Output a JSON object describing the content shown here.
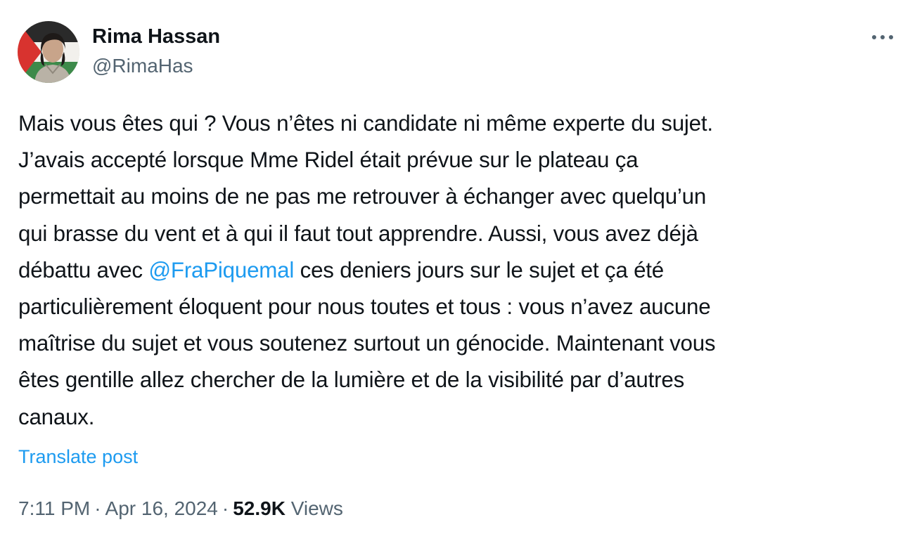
{
  "author": {
    "display_name": "Rima Hassan",
    "handle": "@RimaHas"
  },
  "post": {
    "lines": [
      [
        "Mais vous êtes qui ? Vous n’êtes ni candidate ni même experte du sujet."
      ],
      [
        "J’avais accepté lorsque Mme Ridel était prévue sur le plateau ça"
      ],
      [
        "permettait au moins de ne pas me retrouver à échanger avec quelqu’un"
      ],
      [
        "qui brasse du vent et à qui il faut tout apprendre. Aussi, vous avez déjà"
      ],
      [
        "débattu avec ",
        "@FraPiquemal",
        " ces deniers jours sur le sujet et ça été"
      ],
      [
        "particulièrement éloquent pour nous toutes et tous : vous n’avez aucune"
      ],
      [
        "maîtrise du sujet et vous soutenez surtout un génocide. Maintenant vous"
      ],
      [
        "êtes gentille allez chercher de la lumière et de la visibilité par d’autres"
      ],
      [
        "canaux."
      ]
    ],
    "translate_label": "Translate post"
  },
  "meta": {
    "time": "7:11 PM",
    "separator": "·",
    "date": "Apr 16, 2024",
    "views_count": "52.9K",
    "views_label": "Views"
  },
  "icons": {
    "more": "more-horizontal-icon",
    "avatar": "profile-avatar"
  },
  "colors": {
    "text": "#0f1419",
    "secondary": "#536471",
    "link": "#1d9bf0",
    "background": "#ffffff"
  }
}
